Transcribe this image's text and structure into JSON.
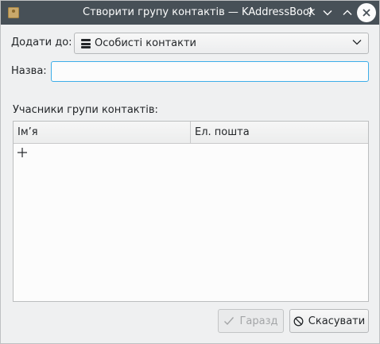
{
  "window": {
    "title": "Створити групу контактів — KAddressBook",
    "help_glyph": "?",
    "icons": [
      "app-icon",
      "help-icon",
      "minimize-icon",
      "maximize-icon",
      "close-icon"
    ]
  },
  "form": {
    "add_to_label": "Додати до:",
    "add_to_value": "Особисті контакти",
    "name_label": "Назва:",
    "name_value": "",
    "members_label": "Учасники групи контактів:"
  },
  "table": {
    "columns": [
      "Ім’я",
      "Ел. пошта"
    ],
    "rows": []
  },
  "buttons": {
    "ok_label": "Гаразд",
    "ok_enabled": false,
    "cancel_label": "Скасувати"
  },
  "colors": {
    "titlebar": "#475057",
    "focus": "#3daee9",
    "background": "#eff0f1"
  }
}
